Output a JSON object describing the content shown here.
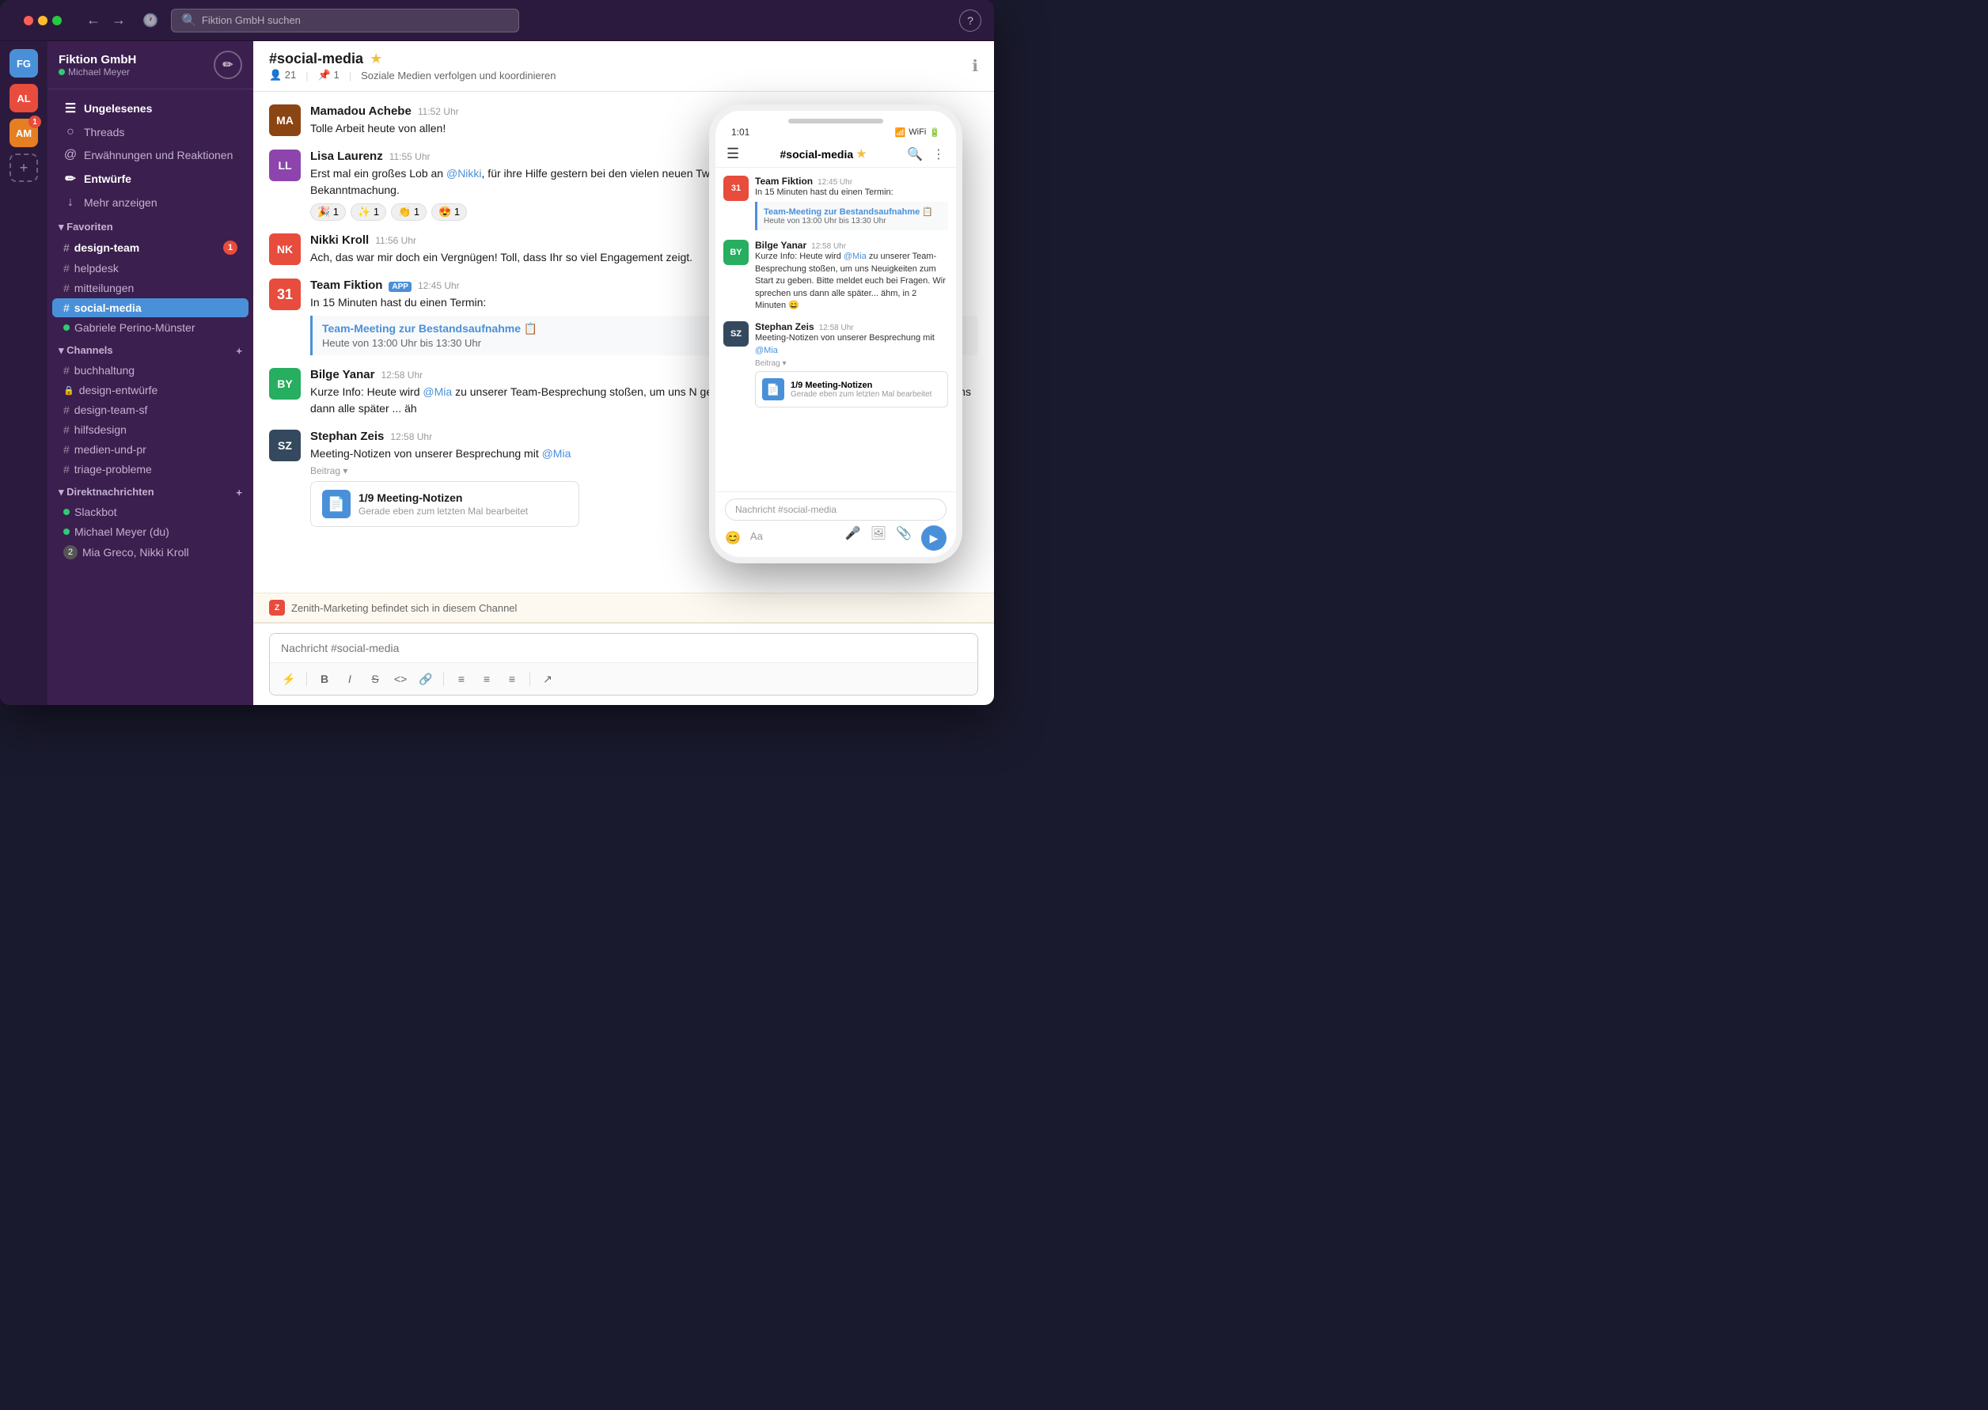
{
  "app": {
    "mac_buttons": [
      "red",
      "yellow",
      "green"
    ],
    "search_placeholder": "Fiktion GmbH suchen",
    "help": "?"
  },
  "workspace": {
    "initials": "FG",
    "name": "Fiktion GmbH",
    "chevron": "▾",
    "user": "Michael Meyer",
    "status": "online"
  },
  "sidebar_icons": [
    {
      "initials": "AL",
      "color": "#e74c3c"
    },
    {
      "initials": "AM",
      "color": "#e67e22",
      "badge": "1"
    }
  ],
  "nav": {
    "items": [
      {
        "icon": "☰",
        "label": "Ungelesenes",
        "bold": true
      },
      {
        "icon": "○",
        "label": "Threads"
      },
      {
        "icon": "@",
        "label": "Erwähnungen und Reaktionen"
      },
      {
        "icon": "✏",
        "label": "Entwürfe",
        "bold": true
      },
      {
        "icon": "↓",
        "label": "Mehr anzeigen"
      }
    ]
  },
  "favorites": {
    "header": "Favoriten",
    "channels": [
      {
        "name": "design-team",
        "badge": "1",
        "bold": true
      },
      {
        "name": "helpdesk"
      },
      {
        "name": "mitteilungen"
      },
      {
        "name": "social-media",
        "active": true
      }
    ],
    "dm": {
      "name": "Gabriele Perino-Münster",
      "status": "online"
    }
  },
  "channels_section": {
    "header": "Channels",
    "items": [
      {
        "name": "buchhaltung",
        "locked": false
      },
      {
        "name": "design-entwürfe",
        "locked": true
      },
      {
        "name": "design-team-sf",
        "locked": false
      },
      {
        "name": "hilfsdesign",
        "locked": false
      },
      {
        "name": "medien-und-pr",
        "locked": false
      },
      {
        "name": "triage-probleme",
        "locked": false
      }
    ]
  },
  "dm_section": {
    "header": "Direktnachrichten",
    "items": [
      {
        "name": "Slackbot",
        "status": "online"
      },
      {
        "name": "Michael Meyer (du)",
        "status": "online"
      },
      {
        "name": "Mia Greco, Nikki Kroll",
        "number": "2"
      }
    ]
  },
  "channel": {
    "name": "#social-media",
    "starred": true,
    "members": "21",
    "pinned": "1",
    "description": "Soziale Medien verfolgen und koordinieren"
  },
  "messages": [
    {
      "id": "msg1",
      "sender": "Mamadou Achebe",
      "time": "11:52 Uhr",
      "text": "Tolle Arbeit heute von allen!",
      "avatar_color": "#c0392b",
      "avatar_initials": "MA"
    },
    {
      "id": "msg2",
      "sender": "Lisa Laurenz",
      "time": "11:55 Uhr",
      "text": "Erst mal ein großes Lob an @Nikki, für ihre Hilfe gestern bei den vielen neuen Tweets. Alle sind ganz begeistert wegen der gestrigen Bekanntmachung.",
      "avatar_color": "#8e44ad",
      "avatar_initials": "LL",
      "reactions": [
        {
          "emoji": "🎉",
          "count": "1"
        },
        {
          "emoji": "✨",
          "count": "1"
        },
        {
          "emoji": "👏",
          "count": "1"
        },
        {
          "emoji": "😍",
          "count": "1"
        }
      ]
    },
    {
      "id": "msg3",
      "sender": "Nikki Kroll",
      "time": "11:56 Uhr",
      "text": "Ach, das war mir doch ein Vergnügen! Toll, dass Ihr so viel Engagement zeigt.",
      "avatar_color": "#e74c3c",
      "avatar_initials": "NK"
    },
    {
      "id": "msg4",
      "sender": "Team Fiktion",
      "is_app": true,
      "time": "12:45 Uhr",
      "text": "In 15 Minuten hast du einen Termin:",
      "avatar_color": "#e74c3c",
      "avatar_type": "calendar",
      "event": {
        "title": "Team-Meeting zur Bestandsaufnahme 📋",
        "time": "Heute von 13:00 Uhr bis 13:30 Uhr"
      }
    },
    {
      "id": "msg5",
      "sender": "Bilge Yanar",
      "time": "12:58 Uhr",
      "text": "Kurze Info: Heute wird @Mia zu unserer Team-Besprechung stoßen, um uns N geben. Bitte meldet euch bei Fragen. Wir sprechen uns dann alle später ... äh",
      "avatar_color": "#27ae60",
      "avatar_initials": "BY"
    },
    {
      "id": "msg6",
      "sender": "Stephan Zeis",
      "time": "12:58 Uhr",
      "text": "Meeting-Notizen von unserer Besprechung mit @Mia",
      "avatar_color": "#34495e",
      "avatar_initials": "SZ",
      "beitrag": "Beitrag ▾",
      "attachment": {
        "title": "1/9 Meeting-Notizen",
        "subtitle": "Gerade eben zum letzten Mal bearbeitet",
        "icon": "📄"
      }
    }
  ],
  "join_banner": {
    "avatar": "Z",
    "text": "Zenith-Marketing befindet sich in diesem Channel"
  },
  "input": {
    "placeholder": "Nachricht #social-media",
    "toolbar": [
      "⚡",
      "B",
      "I",
      "S̶",
      "<>",
      "🔗",
      "≡",
      "≡",
      "≡",
      "↗"
    ]
  },
  "phone": {
    "time": "1:01",
    "channel": "#social-media",
    "starred": true,
    "messages": [
      {
        "sender": "Team Fiktion",
        "time": "12:45 Uhr",
        "text": "In 15 Minuten hast du einen Termin:",
        "type": "calendar",
        "event": {
          "title": "Team-Meeting zur Bestandsaufnahme 📋",
          "time": "Heute von 13:00 Uhr bis 13:30 Uhr"
        }
      },
      {
        "sender": "Bilge Yanar",
        "time": "12:58 Uhr",
        "text": "Kurze Info: Heute wird @Mia zu unserer Team-Besprechung stoßen, um uns Neuigkeiten zum Start zu geben. Bitte meldet euch bei Fragen. Wir sprechen uns dann alle später... ähm, in 2 Minuten 😄",
        "type": "user",
        "avatar_color": "#27ae60"
      },
      {
        "sender": "Stephan Zeis",
        "time": "12:58 Uhr",
        "text": "Meeting-Notizen von unserer Besprechung mit @Mia",
        "type": "user",
        "avatar_color": "#34495e",
        "beitrag": "Beitrag ▾",
        "attachment": {
          "title": "1/9 Meeting-Notizen",
          "subtitle": "Gerade eben zum letzten Mal bearbeitet"
        }
      }
    ],
    "input_placeholder": "Nachricht #social-media"
  }
}
